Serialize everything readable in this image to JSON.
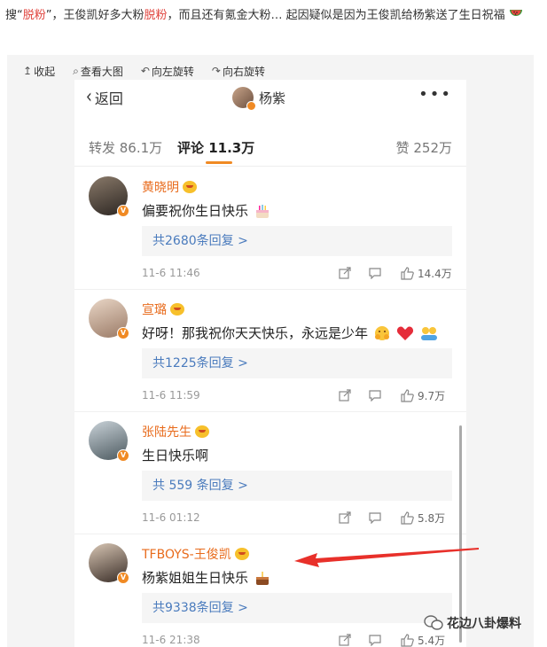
{
  "intro": {
    "p1": "搜“",
    "hl1": "脱粉",
    "p2": "”，王俊凯好多大粉",
    "hl2": "脱粉",
    "p3": "，而且还有氪金大粉… 起因疑似是因为王俊凯给杨紫送了生日祝福",
    "emoji_icon": "watermelon-icon"
  },
  "toolbar": {
    "collapse": "收起",
    "view_large": "查看大图",
    "rotate_left": "向左旋转",
    "rotate_right": "向右旋转"
  },
  "topbar": {
    "back": "返回",
    "user": "杨紫",
    "more": "•••"
  },
  "tabs": {
    "reposts": "转发 86.1万",
    "comments": "评论 11.3万",
    "likes": "赞 252万"
  },
  "comments": [
    {
      "name": "黄晓明",
      "text": "偏要祝你生日快乐",
      "replies": "共2680条回复 >",
      "time": "11-6 11:46",
      "likes": "14.4万"
    },
    {
      "name": "宣璐",
      "text": "好呀！那我祝你天天快乐，永远是少年",
      "replies": "共1225条回复 >",
      "time": "11-6 11:59",
      "likes": "9.7万"
    },
    {
      "name": "张陆先生",
      "text": "生日快乐啊",
      "replies": "共 559 条回复 >",
      "time": "11-6 01:12",
      "likes": "5.8万"
    },
    {
      "name": "TFBOYS-王俊凯",
      "text": "杨紫姐姐生日快乐",
      "replies": "共9338条回复 >",
      "time": "11-6 21:38",
      "likes": "5.4万"
    }
  ],
  "watermark": "花边八卦爆料",
  "colors": {
    "accent": "#f08a24",
    "name": "#e86b1c",
    "link": "#4a7bbd",
    "arrow": "#e8302a"
  }
}
